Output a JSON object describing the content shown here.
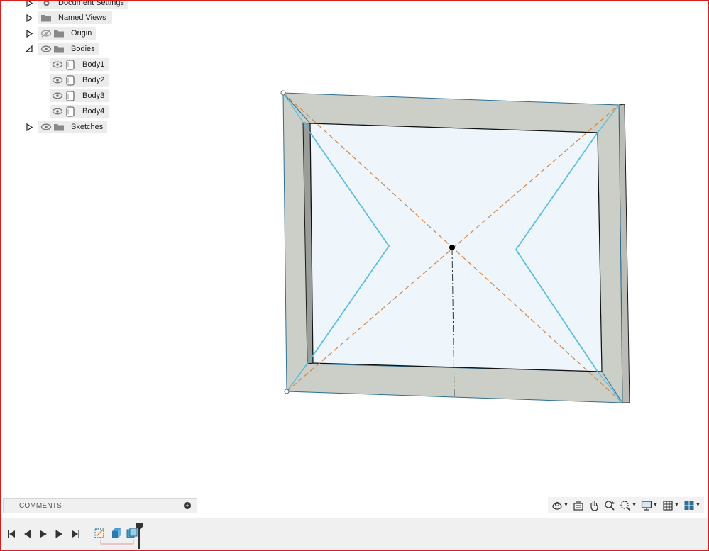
{
  "browser": {
    "items": [
      {
        "label": "Document Settings",
        "toggle": "collapsed",
        "visible": null,
        "icon": "gear"
      },
      {
        "label": "Named Views",
        "toggle": "collapsed",
        "visible": null,
        "icon": "folder"
      },
      {
        "label": "Origin",
        "toggle": "collapsed",
        "visible": false,
        "icon": "folder"
      },
      {
        "label": "Bodies",
        "toggle": "expanded",
        "visible": true,
        "icon": "folder"
      },
      {
        "label": "Body1",
        "toggle": null,
        "visible": true,
        "icon": "body"
      },
      {
        "label": "Body2",
        "toggle": null,
        "visible": true,
        "icon": "body"
      },
      {
        "label": "Body3",
        "toggle": null,
        "visible": true,
        "icon": "body"
      },
      {
        "label": "Body4",
        "toggle": null,
        "visible": true,
        "icon": "body"
      },
      {
        "label": "Sketches",
        "toggle": "collapsed",
        "visible": true,
        "icon": "folder"
      }
    ]
  },
  "comments": {
    "title": "COMMENTS",
    "add_icon": "plus-circle-icon"
  },
  "nav_toolbar": {
    "tools": [
      "orbit-icon",
      "look-at-icon",
      "pan-icon",
      "zoom-icon",
      "fit-icon",
      "display-settings-icon",
      "grid-settings-icon",
      "viewports-icon"
    ]
  },
  "timeline": {
    "controls": [
      "go-to-start-icon",
      "step-back-icon",
      "play-icon",
      "step-forward-icon",
      "go-to-end-icon"
    ],
    "features": [
      "sketch-feature-icon",
      "extrude-feature-icon",
      "component-feature-icon"
    ]
  },
  "colors": {
    "frame_face": "#cbcfc8",
    "glass": "#eef6fb",
    "edge": "#2e6f93",
    "sketch": "#5bbde0",
    "construction": "#d28a4e",
    "red_border": "#d42020"
  }
}
